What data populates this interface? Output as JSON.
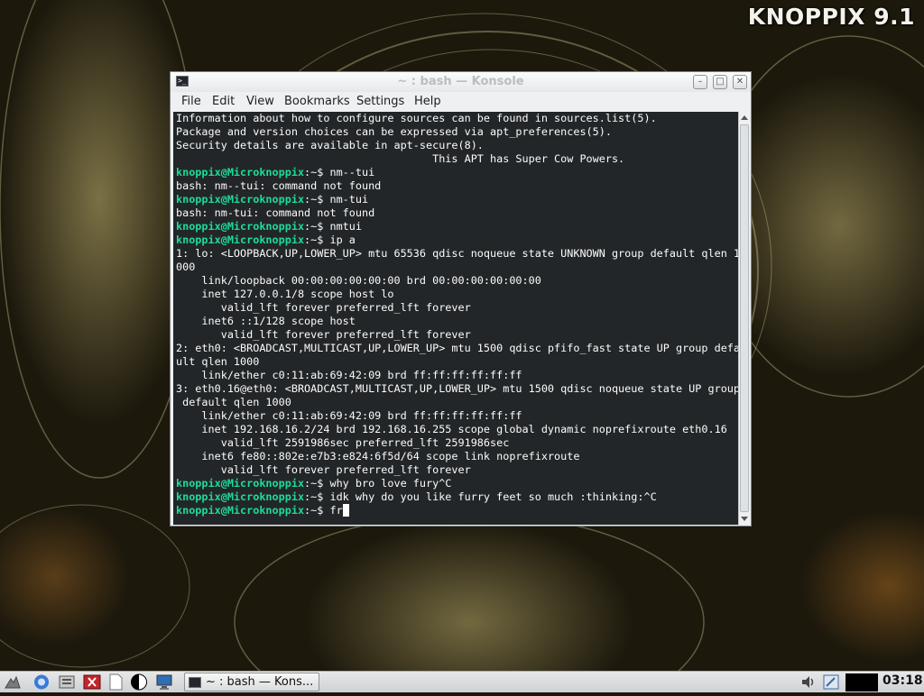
{
  "desktop": {
    "brand": "KNOPPIX 9.1"
  },
  "window": {
    "title": "~ : bash — Konsole",
    "buttons": {
      "minimize": "minimize-icon",
      "maximize": "maximize-icon",
      "close": "close-icon"
    },
    "menu": [
      "File",
      "Edit",
      "View",
      "Bookmarks",
      "Settings",
      "Help"
    ]
  },
  "terminal": {
    "prompt": "knoppix@Microknoppix",
    "lines": [
      {
        "text": "Information about how to configure sources can be found in sources.list(5)."
      },
      {
        "text": "Package and version choices can be expressed via apt_preferences(5)."
      },
      {
        "text": "Security details are available in apt-secure(8)."
      },
      {
        "text": "                                        This APT has Super Cow Powers."
      },
      {
        "prompt": true,
        "text": "nm--tui"
      },
      {
        "text": "bash: nm--tui: command not found"
      },
      {
        "prompt": true,
        "text": "nm-tui"
      },
      {
        "text": "bash: nm-tui: command not found"
      },
      {
        "prompt": true,
        "text": "nmtui"
      },
      {
        "prompt": true,
        "text": "ip a"
      },
      {
        "text": "1: lo: <LOOPBACK,UP,LOWER_UP> mtu 65536 qdisc noqueue state UNKNOWN group default qlen 1"
      },
      {
        "text": "000"
      },
      {
        "text": "    link/loopback 00:00:00:00:00:00 brd 00:00:00:00:00:00"
      },
      {
        "text": "    inet 127.0.0.1/8 scope host lo"
      },
      {
        "text": "       valid_lft forever preferred_lft forever"
      },
      {
        "text": "    inet6 ::1/128 scope host"
      },
      {
        "text": "       valid_lft forever preferred_lft forever"
      },
      {
        "text": "2: eth0: <BROADCAST,MULTICAST,UP,LOWER_UP> mtu 1500 qdisc pfifo_fast state UP group defa"
      },
      {
        "text": "ult qlen 1000"
      },
      {
        "text": "    link/ether c0:11:ab:69:42:09 brd ff:ff:ff:ff:ff:ff"
      },
      {
        "text": "3: eth0.16@eth0: <BROADCAST,MULTICAST,UP,LOWER_UP> mtu 1500 qdisc noqueue state UP group"
      },
      {
        "text": " default qlen 1000"
      },
      {
        "text": "    link/ether c0:11:ab:69:42:09 brd ff:ff:ff:ff:ff:ff"
      },
      {
        "text": "    inet 192.168.16.2/24 brd 192.168.16.255 scope global dynamic noprefixroute eth0.16"
      },
      {
        "text": "       valid_lft 2591986sec preferred_lft 2591986sec"
      },
      {
        "text": "    inet6 fe80::802e:e7b3:e824:6f5d/64 scope link noprefixroute"
      },
      {
        "text": "       valid_lft forever preferred_lft forever"
      },
      {
        "prompt": true,
        "text": "why bro love fury^C"
      },
      {
        "prompt": true,
        "text": "idk why do you like furry feet so much :thinking:^C"
      },
      {
        "prompt": true,
        "text": "fr",
        "cursor": true
      }
    ]
  },
  "taskbar": {
    "launchers": [
      "menu-icon",
      "browser-icon",
      "file-manager-icon",
      "media-icon",
      "document-icon",
      "contrast-icon",
      "monitor-icon"
    ],
    "task_label": "~ : bash — Kons...",
    "tray": [
      "volume-icon",
      "network-icon"
    ],
    "clock": "03:18"
  },
  "colors": {
    "terminal_bg": "#232628",
    "terminal_fg": "#fcfcfc",
    "prompt": "#1cdc9a",
    "window_chrome": "#eef0f1"
  }
}
